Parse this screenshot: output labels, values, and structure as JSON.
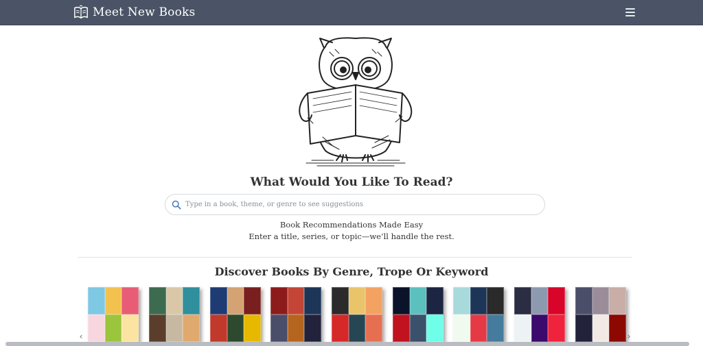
{
  "navbar": {
    "brand_icon": "open-book-icon",
    "brand_text": "Meet New Books",
    "menu_icon": "hamburger-menu-icon",
    "background": "#4a5466"
  },
  "hero": {
    "illustration": "owl-reading-book-illustration",
    "headline": "What Would You Like To Read?"
  },
  "search": {
    "icon": "search-icon",
    "placeholder": "Type in a book, theme, or genre to see suggestions",
    "value": ""
  },
  "tagline": {
    "line1": "Book Recommendations Made Easy",
    "line2": "Enter a title, series, or topic—we’ll handle the rest."
  },
  "genres": {
    "title": "Discover Books By Genre, Trope Or Keyword",
    "prev_icon": "chevron-left-icon",
    "next_icon": "chevron-right-icon",
    "tiles": [
      {
        "colors": [
          "#7ec8e3",
          "#f2c14e",
          "#e85d75",
          "#f7d6e0",
          "#9bc53d",
          "#fbe3a1"
        ]
      },
      {
        "colors": [
          "#3d6b4f",
          "#d9c7a7",
          "#2f8f9d",
          "#5a3e2b",
          "#c7b8a1",
          "#e0a96d"
        ]
      },
      {
        "colors": [
          "#1f3b73",
          "#d4a373",
          "#7a1f1f",
          "#c0392b",
          "#2e4a2e",
          "#e6b800"
        ]
      },
      {
        "colors": [
          "#8e1b1b",
          "#c44536",
          "#1d3557",
          "#4a4e69",
          "#b5651d",
          "#22223b"
        ]
      },
      {
        "colors": [
          "#2b2b2b",
          "#e9c46a",
          "#f4a261",
          "#d62828",
          "#264653",
          "#e76f51"
        ]
      },
      {
        "colors": [
          "#0b132b",
          "#5bc0be",
          "#1c2541",
          "#c1121f",
          "#3a506b",
          "#6fffe9"
        ]
      },
      {
        "colors": [
          "#a8dadc",
          "#1d3557",
          "#2a2a2a",
          "#f1faee",
          "#e63946",
          "#457b9d"
        ]
      },
      {
        "colors": [
          "#2b2d42",
          "#8d99ae",
          "#d90429",
          "#edf2f4",
          "#3c096c",
          "#ef233c"
        ]
      },
      {
        "colors": [
          "#4a4e69",
          "#9a8c98",
          "#c9ada7",
          "#22223b",
          "#f2e9e4",
          "#8d0801"
        ]
      }
    ]
  }
}
